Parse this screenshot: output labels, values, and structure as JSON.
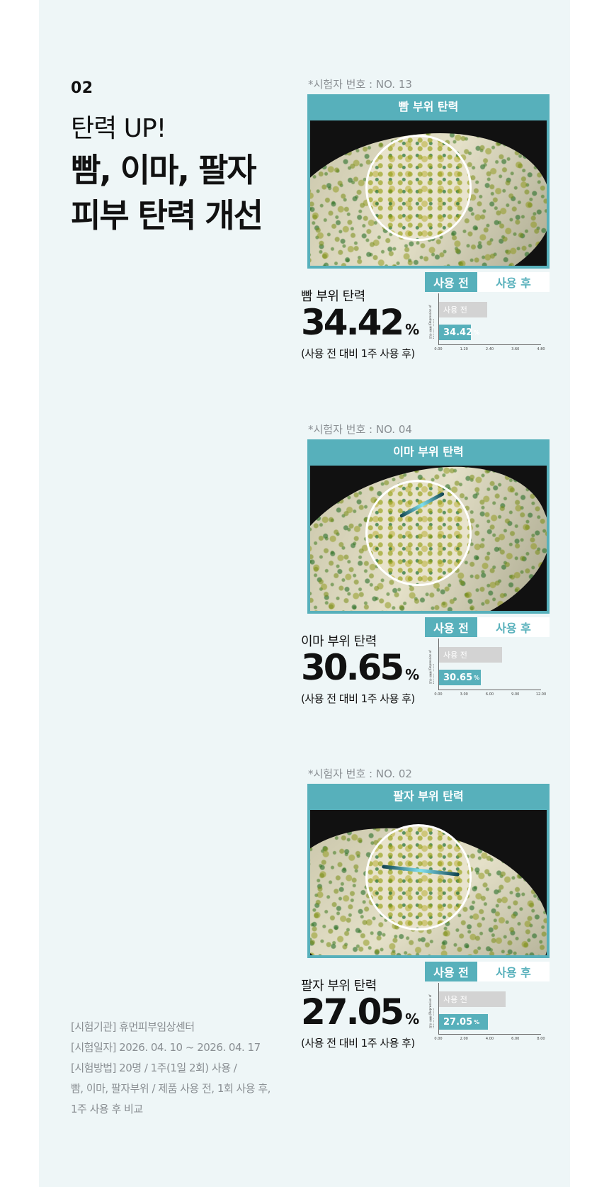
{
  "header": {
    "number": "02",
    "headline_small": "탄력 UP!",
    "headline_lines": [
      "빰, 이마, 팔자",
      "피부 탄력 개선"
    ]
  },
  "test_info": [
    "[시험기관] 휴먼피부임상센터",
    "[시험일자] 2026. 04. 10 ~ 2026. 04. 17",
    "[시험방법] 20명 / 1주(1일 2회) 사용 /",
    "빰, 이마, 팔자부위 / 제품 사용 전, 1회 사용 후,",
    "1주 사용 후 비교"
  ],
  "tabs": {
    "before": "사용 전",
    "after": "사용 후"
  },
  "blocks": [
    {
      "subject": "*시험자 번호 : NO. 13",
      "frame_title": "빰 부위 탄력",
      "stat_label": "빰 부위 탄력",
      "stat_value": "34.42",
      "stat_unit": "%",
      "stat_note": "(사용 전 대비 1주 사용 후)",
      "chart_data": {
        "type": "bar",
        "categories": [
          "사용 전",
          "사용 후"
        ],
        "values": [
          2.25,
          1.5
        ],
        "value_labels": [
          "",
          "34.42%"
        ],
        "ylabel": "피부 볼륨 (Depression of Volume, mm³)",
        "xticks": [
          "0.00",
          "1.20",
          "2.40",
          "3.60",
          "4.80"
        ],
        "xlim": [
          0,
          4.8
        ]
      }
    },
    {
      "subject": "*시험자 번호 : NO. 04",
      "frame_title": "이마 부위 탄력",
      "stat_label": "이마 부위 탄력",
      "stat_value": "30.65",
      "stat_unit": "%",
      "stat_note": "(사용 전 대비 1주 사용 후)",
      "chart_data": {
        "type": "bar",
        "categories": [
          "사용 전",
          "사용 후"
        ],
        "values": [
          7.4,
          4.9
        ],
        "value_labels": [
          "",
          "30.65%"
        ],
        "ylabel": "피부 볼륨 (Depression of Volume, mm³)",
        "xticks": [
          "0.00",
          "3.00",
          "6.00",
          "9.00",
          "12.00"
        ],
        "xlim": [
          0,
          12
        ]
      }
    },
    {
      "subject": "*시험자 번호 : NO. 02",
      "frame_title": "팔자 부위 탄력",
      "stat_label": "팔자 부위 탄력",
      "stat_value": "27.05",
      "stat_unit": "%",
      "stat_note": "(사용 전 대비 1주 사용 후)",
      "chart_data": {
        "type": "bar",
        "categories": [
          "사용 전",
          "사용 후"
        ],
        "values": [
          5.2,
          3.8
        ],
        "value_labels": [
          "",
          "27.05%"
        ],
        "ylabel": "피부 볼륨 (Depression of Volume, mm³)",
        "xticks": [
          "0.00",
          "2.00",
          "4.00",
          "6.00",
          "8.00"
        ],
        "xlim": [
          0,
          8
        ]
      }
    }
  ],
  "colors": {
    "accent": "#57b0bb",
    "panel": "#eef6f7",
    "bar_before": "#d3d3d3"
  }
}
